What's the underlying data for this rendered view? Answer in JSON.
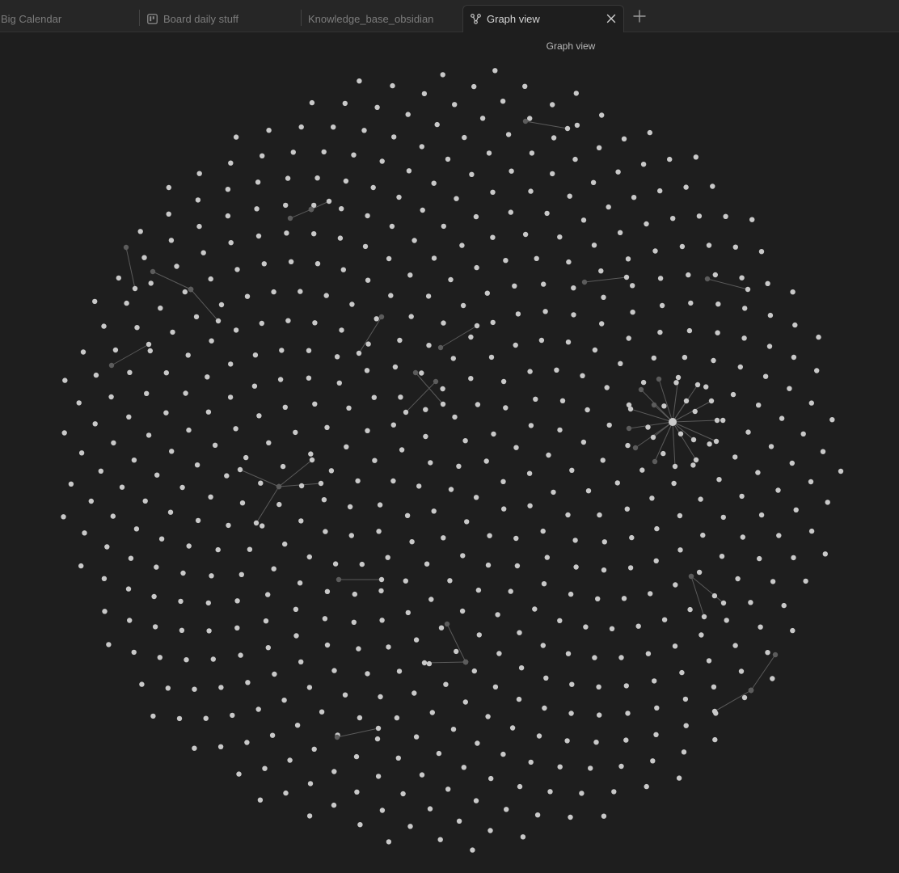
{
  "tabs": [
    {
      "label": "Big Calendar",
      "icon": "none"
    },
    {
      "label": "Board daily stuff",
      "icon": "kanban-board-icon"
    },
    {
      "label": "Knowledge_base_obsidian",
      "icon": "none"
    },
    {
      "label": "Graph view",
      "icon": "graph-icon",
      "active": true
    }
  ],
  "view": {
    "title": "Graph view"
  },
  "colors": {
    "background": "#1e1e1e",
    "tabbar": "#262626",
    "node": "#c9c9c9",
    "node_dim": "#5c5c5c",
    "edge": "#5a5a5a"
  }
}
